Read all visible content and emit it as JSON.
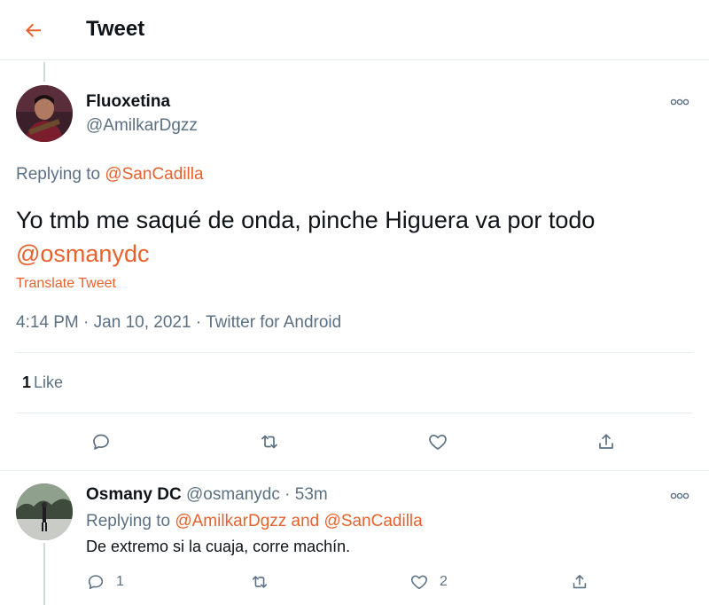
{
  "header": {
    "title": "Tweet",
    "back_icon": "arrow-left-icon",
    "accent": "#e8612c"
  },
  "main_tweet": {
    "author_name": "Fluoxetina",
    "author_handle": "@AmilkarDgzz",
    "replying_prefix": "Replying to",
    "replying_to": "@SanCadilla",
    "text": "Yo tmb me saqué de onda, pinche Higuera va por todo",
    "mention": "@osmanydc",
    "translate_label": "Translate Tweet",
    "time": "4:14 PM",
    "date": "Jan 10, 2021",
    "source": "Twitter for Android",
    "separator": " · ",
    "like_count": "1",
    "like_label": "Like",
    "actions": [
      "reply-icon",
      "retweet-icon",
      "heart-icon",
      "share-icon"
    ]
  },
  "reply": {
    "author_name": "Osmany DC",
    "author_handle": "@osmanydc",
    "time_ago": "53m",
    "separator": " · ",
    "replying_prefix": "Replying to",
    "replying_to_1": "@AmilkarDgzz",
    "and_word": "and",
    "replying_to_2": "@SanCadilla",
    "text": "De extremo si la cuaja, corre machín.",
    "reply_count": "1",
    "retweet_count": "",
    "like_count": "2"
  },
  "colors": {
    "text": "#0f1419",
    "secondary": "#5b7083",
    "border": "#e6ecf0",
    "accent": "#e8612c"
  }
}
